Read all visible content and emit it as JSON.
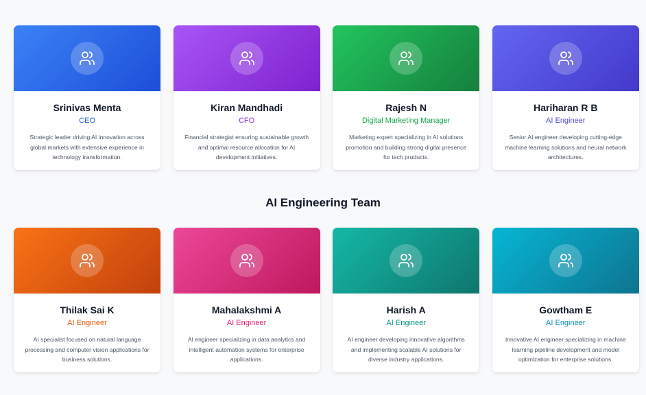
{
  "leadership": [
    {
      "name": "Srinivas Menta",
      "role": "CEO",
      "description": "Strategic leader driving AI innovation across global markets with extensive experience in technology transformation.",
      "gradient": [
        "#3b82f6",
        "#1d4ed8"
      ],
      "role_color": "#2563eb",
      "icon": "users-icon"
    },
    {
      "name": "Kiran Mandhadi",
      "role": "CFO",
      "description": "Financial strategist ensuring sustainable growth and optimal resource allocation for AI development initiatives.",
      "gradient": [
        "#a855f7",
        "#7e22ce"
      ],
      "role_color": "#9333ea",
      "icon": "users-icon"
    },
    {
      "name": "Rajesh N",
      "role": "Digital Marketing Manager",
      "description": "Marketing expert specializing in AI solutions promotion and building strong digital presence for tech products.",
      "gradient": [
        "#22c55e",
        "#15803d"
      ],
      "role_color": "#16a34a",
      "icon": "users-icon"
    },
    {
      "name": "Hariharan R B",
      "role": "AI Engineer",
      "description": "Senior AI engineer developing cutting-edge machine learning solutions and neural network architectures.",
      "gradient": [
        "#6366f1",
        "#4338ca"
      ],
      "role_color": "#4f46e5",
      "icon": "users-icon"
    }
  ],
  "section_title": "AI Engineering Team",
  "engineering": [
    {
      "name": "Thilak Sai K",
      "role": "AI Engineer",
      "description": "AI specialist focused on natural language processing and computer vision applications for business solutions.",
      "gradient": [
        "#f97316",
        "#c2410c"
      ],
      "role_color": "#ea580c",
      "icon": "users-icon"
    },
    {
      "name": "Mahalakshmi A",
      "role": "AI Engineer",
      "description": "AI engineer specializing in data analytics and intelligent automation systems for enterprise applications.",
      "gradient": [
        "#ec4899",
        "#be185d"
      ],
      "role_color": "#db2777",
      "icon": "users-icon"
    },
    {
      "name": "Harish A",
      "role": "AI Engineer",
      "description": "AI engineer developing innovative algorithms and implementing scalable AI solutions for diverse industry applications.",
      "gradient": [
        "#14b8a6",
        "#0f766e"
      ],
      "role_color": "#0d9488",
      "icon": "users-icon"
    },
    {
      "name": "Gowtham E",
      "role": "AI Engineer",
      "description": "Innovative AI engineer specializing in machine learning pipeline development and model optimization for enterprise solutions.",
      "gradient": [
        "#06b6d4",
        "#0e7490"
      ],
      "role_color": "#0891b2",
      "icon": "users-icon"
    }
  ]
}
